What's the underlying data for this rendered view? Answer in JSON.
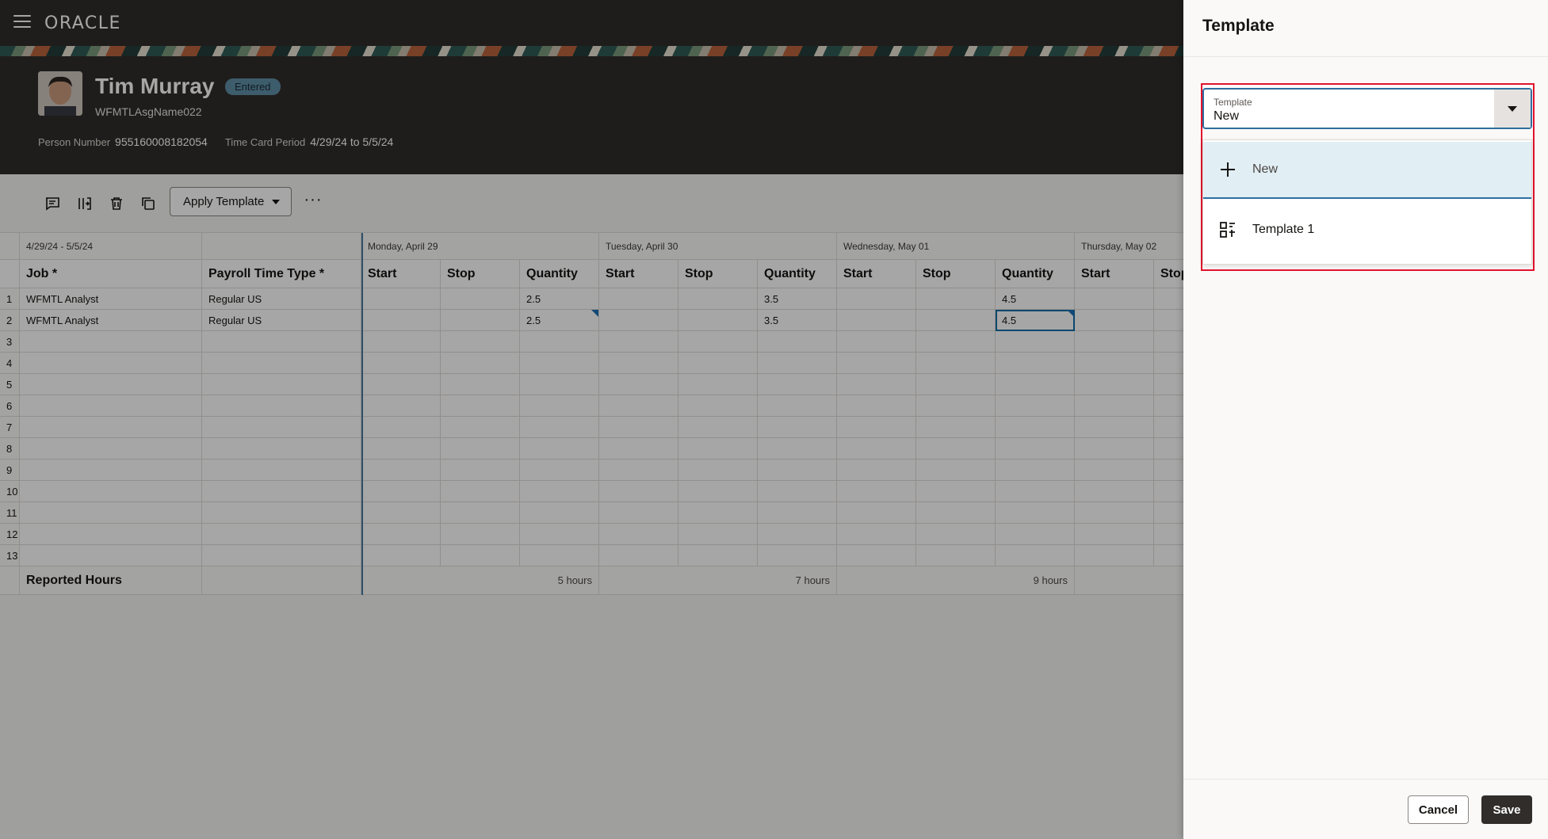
{
  "app": {
    "logo": "ORACLE"
  },
  "person": {
    "name": "Tim Murray",
    "status": "Entered",
    "assignment": "WFMTLAsgName022",
    "person_number_label": "Person Number",
    "person_number": "955160008182054",
    "period_label": "Time Card Period",
    "period": "4/29/24 to 5/5/24"
  },
  "toolbar": {
    "apply_template_label": "Apply Template",
    "more_label": "···"
  },
  "grid": {
    "period_range": "4/29/24 - 5/5/24",
    "job_header": "Job *",
    "payroll_header": "Payroll Time Type *",
    "days": [
      {
        "label": "Monday, April 29",
        "total": "5 hours"
      },
      {
        "label": "Tuesday, April 30",
        "total": "7 hours"
      },
      {
        "label": "Wednesday, May 01",
        "total": "9 hours"
      },
      {
        "label": "Thursday, May 02",
        "total": ""
      }
    ],
    "subcols": [
      "Start",
      "Stop",
      "Quantity"
    ],
    "rows": [
      {
        "num": "1",
        "job": "WFMTL Analyst",
        "type": "Regular US",
        "q": [
          "2.5",
          "3.5",
          "4.5",
          ""
        ]
      },
      {
        "num": "2",
        "job": "WFMTL Analyst",
        "type": "Regular US",
        "q": [
          "2.5",
          "3.5",
          "4.5",
          ""
        ]
      },
      {
        "num": "3",
        "job": "",
        "type": "",
        "q": [
          "",
          "",
          "",
          ""
        ]
      },
      {
        "num": "4",
        "job": "",
        "type": "",
        "q": [
          "",
          "",
          "",
          ""
        ]
      },
      {
        "num": "5",
        "job": "",
        "type": "",
        "q": [
          "",
          "",
          "",
          ""
        ]
      },
      {
        "num": "6",
        "job": "",
        "type": "",
        "q": [
          "",
          "",
          "",
          ""
        ]
      },
      {
        "num": "7",
        "job": "",
        "type": "",
        "q": [
          "",
          "",
          "",
          ""
        ]
      },
      {
        "num": "8",
        "job": "",
        "type": "",
        "q": [
          "",
          "",
          "",
          ""
        ]
      },
      {
        "num": "9",
        "job": "",
        "type": "",
        "q": [
          "",
          "",
          "",
          ""
        ]
      },
      {
        "num": "10",
        "job": "",
        "type": "",
        "q": [
          "",
          "",
          "",
          ""
        ]
      },
      {
        "num": "11",
        "job": "",
        "type": "",
        "q": [
          "",
          "",
          "",
          ""
        ]
      },
      {
        "num": "12",
        "job": "",
        "type": "",
        "q": [
          "",
          "",
          "",
          ""
        ]
      },
      {
        "num": "13",
        "job": "",
        "type": "",
        "q": [
          "",
          "",
          "",
          ""
        ]
      }
    ],
    "footer_label": "Reported Hours"
  },
  "drawer": {
    "title": "Template",
    "select_label": "Template",
    "select_value": "New",
    "options": [
      {
        "label": "New",
        "icon": "plus-icon"
      },
      {
        "label": "Template 1",
        "icon": "template-icon"
      }
    ],
    "cancel_label": "Cancel",
    "save_label": "Save"
  },
  "colors": {
    "header_bg": "#312d2a",
    "badge": "#5f8fa6",
    "highlight": "#e1122c",
    "focus": "#2f6e9e",
    "selected_option": "#e1eef4"
  }
}
